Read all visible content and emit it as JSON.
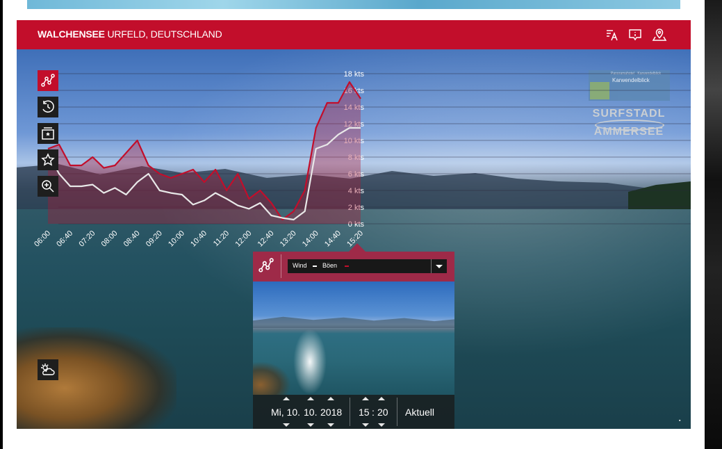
{
  "header": {
    "location_bold": "WALCHENSEE",
    "location_rest": " URFELD, DEUTSCHLAND",
    "icons": [
      "wind-direction-icon",
      "info-icon",
      "map-location-icon"
    ]
  },
  "sidebar": {
    "buttons": [
      {
        "icon": "line-chart-icon",
        "active": true
      },
      {
        "icon": "history-icon",
        "active": false
      },
      {
        "icon": "gallery-icon",
        "active": false
      },
      {
        "icon": "star-icon",
        "active": false
      },
      {
        "icon": "zoom-icon",
        "active": false
      }
    ],
    "weather_icon": "weather-icon"
  },
  "logos": {
    "logo1_line1": "Panoramahotel · Karwendelblick",
    "logo1_line2": "Karwendelblick",
    "logo2_line1": "SURFSTADL",
    "logo2_line2": "AMMERSEE"
  },
  "chart_data": {
    "type": "line",
    "x": [
      "06:00",
      "06:20",
      "06:40",
      "07:00",
      "07:20",
      "07:40",
      "08:00",
      "08:20",
      "08:40",
      "09:00",
      "09:20",
      "09:40",
      "10:00",
      "10:20",
      "10:40",
      "11:00",
      "11:20",
      "11:40",
      "12:00",
      "12:20",
      "12:40",
      "13:00",
      "13:20",
      "13:40",
      "14:00",
      "14:20",
      "14:40",
      "15:00",
      "15:20"
    ],
    "x_tick_labels": [
      "06:00",
      "06:40",
      "07:20",
      "08:00",
      "08:40",
      "09:20",
      "10:00",
      "10:40",
      "11:20",
      "12:00",
      "12:40",
      "13:20",
      "14:00",
      "14:40",
      "15:20"
    ],
    "y_tick_labels": [
      "0 kts",
      "2 kts",
      "4 kts",
      "6 kts",
      "8 kts",
      "10 kts",
      "12 kts",
      "14 kts",
      "16 kts",
      "18 kts"
    ],
    "ylim": [
      0,
      18
    ],
    "ylabel": "",
    "series": [
      {
        "name": "Böen",
        "color": "#c20e2b",
        "values": [
          9,
          9.5,
          7,
          7,
          8,
          6.7,
          7,
          8.5,
          10,
          7,
          6,
          5.5,
          6,
          6.5,
          5,
          6.5,
          4,
          6,
          3,
          4,
          2.5,
          0.5,
          1.5,
          4,
          11.5,
          14.5,
          14.5,
          17,
          15
        ]
      },
      {
        "name": "Wind",
        "color": "#e8e8e8",
        "values": [
          8.5,
          6,
          4.5,
          4.5,
          4.7,
          3.7,
          4.3,
          3.5,
          5,
          6,
          4,
          3.7,
          3.5,
          2.3,
          2.8,
          3.7,
          3,
          2.2,
          1.8,
          2.5,
          1,
          0.7,
          0.5,
          1.5,
          9,
          9.5,
          10.7,
          11.5,
          11.5
        ]
      }
    ],
    "grid": true,
    "legend": "dropdown"
  },
  "panel": {
    "series_label_wind": "Wind",
    "series_label_gusts": "Böen",
    "date_weekday": "Mi, 10.",
    "date_month": "10.",
    "date_year": "2018",
    "time_hour": "15",
    "time_sep": ":",
    "time_minute": "20",
    "current_button": "Aktuell"
  },
  "colors": {
    "accent": "#c20e2b",
    "panel": "#9e2a48",
    "gust_line": "#c20e2b",
    "wind_line": "#e8e8e8"
  }
}
